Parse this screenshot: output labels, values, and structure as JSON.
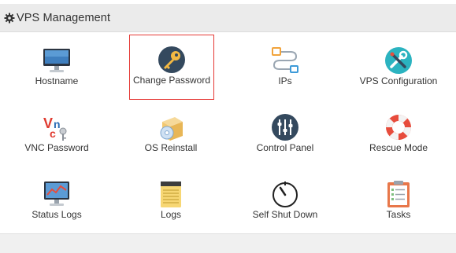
{
  "header": {
    "title": "VPS Management",
    "icon": "gear-icon"
  },
  "tiles": [
    {
      "label": "Hostname",
      "icon": "monitor-icon"
    },
    {
      "label": "Change Password",
      "icon": "key-icon",
      "selected": true
    },
    {
      "label": "IPs",
      "icon": "network-icon"
    },
    {
      "label": "VPS Configuration",
      "icon": "tools-icon"
    },
    {
      "label": "VNC Password",
      "icon": "vnc-key-icon"
    },
    {
      "label": "OS Reinstall",
      "icon": "os-box-icon"
    },
    {
      "label": "Control Panel",
      "icon": "sliders-icon"
    },
    {
      "label": "Rescue Mode",
      "icon": "lifebuoy-icon"
    },
    {
      "label": "Status Logs",
      "icon": "chart-monitor-icon"
    },
    {
      "label": "Logs",
      "icon": "notepad-icon"
    },
    {
      "label": "Self Shut Down",
      "icon": "power-icon"
    },
    {
      "label": "Tasks",
      "icon": "clipboard-icon"
    }
  ],
  "colors": {
    "selected_border": "#e53935",
    "header_bg": "#ebebeb",
    "label_text": "#333333"
  }
}
